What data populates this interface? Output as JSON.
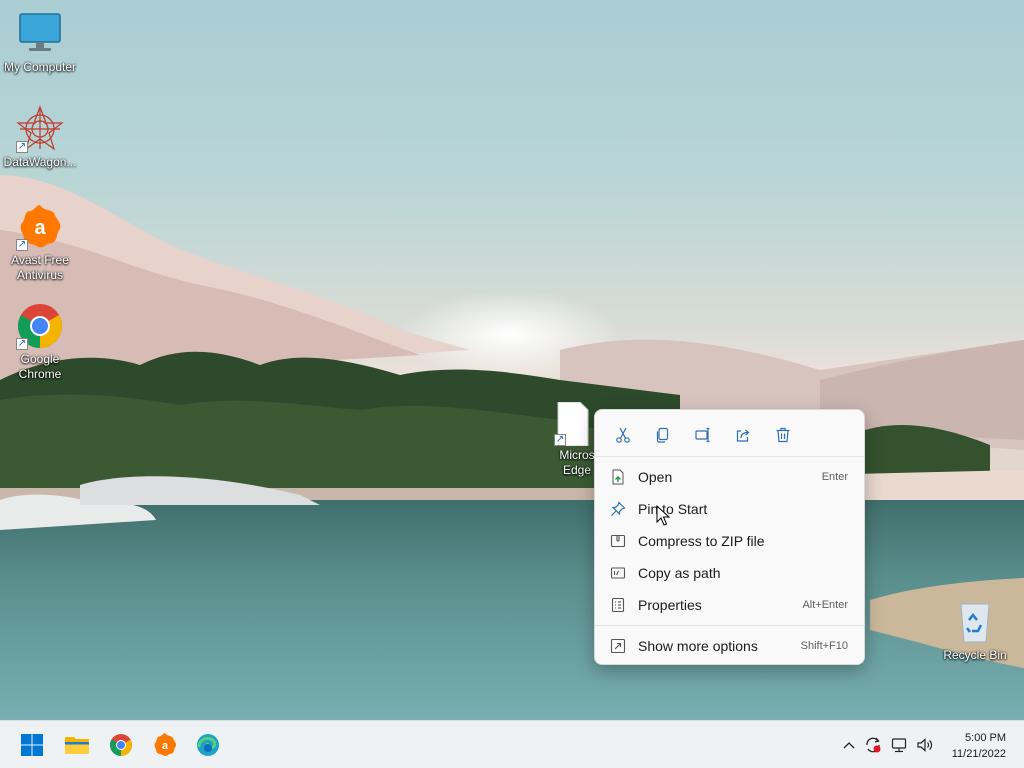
{
  "desktop": {
    "icons": [
      {
        "label": "My Computer",
        "icon": "monitor-icon"
      },
      {
        "label": "DataWagon...",
        "icon": "datawagon-icon"
      },
      {
        "label": "Avast Free Antivirus",
        "icon": "avast-icon"
      },
      {
        "label": "Google Chrome",
        "icon": "chrome-icon"
      },
      {
        "label": "Micros Edge",
        "icon": "file-icon"
      },
      {
        "label": "Recycle Bin",
        "icon": "recycle-bin-icon"
      }
    ]
  },
  "context_menu": {
    "toolbar": [
      {
        "name": "Cut",
        "icon": "scissors-icon"
      },
      {
        "name": "Copy",
        "icon": "copy-icon"
      },
      {
        "name": "Rename",
        "icon": "rename-icon"
      },
      {
        "name": "Share",
        "icon": "share-icon"
      },
      {
        "name": "Delete",
        "icon": "trash-icon"
      }
    ],
    "items": [
      {
        "label": "Open",
        "shortcut": "Enter",
        "icon": "open-file-icon"
      },
      {
        "label": "Pin to Start",
        "shortcut": "",
        "icon": "pin-icon"
      },
      {
        "label": "Compress to ZIP file",
        "shortcut": "",
        "icon": "zip-icon"
      },
      {
        "label": "Copy as path",
        "shortcut": "",
        "icon": "copy-path-icon"
      },
      {
        "label": "Properties",
        "shortcut": "Alt+Enter",
        "icon": "properties-icon"
      }
    ],
    "more": {
      "label": "Show more options",
      "shortcut": "Shift+F10",
      "icon": "more-options-icon"
    }
  },
  "taskbar": {
    "apps": [
      "start-icon",
      "file-explorer-icon",
      "chrome-icon",
      "avast-icon",
      "edge-icon"
    ],
    "tray": [
      "chevron-up-icon",
      "sync-icon",
      "network-icon",
      "volume-icon"
    ],
    "time": "5:00 PM",
    "date": "11/21/2022"
  },
  "colors": {
    "accent": "#0067c0",
    "avast": "#ff7800"
  }
}
